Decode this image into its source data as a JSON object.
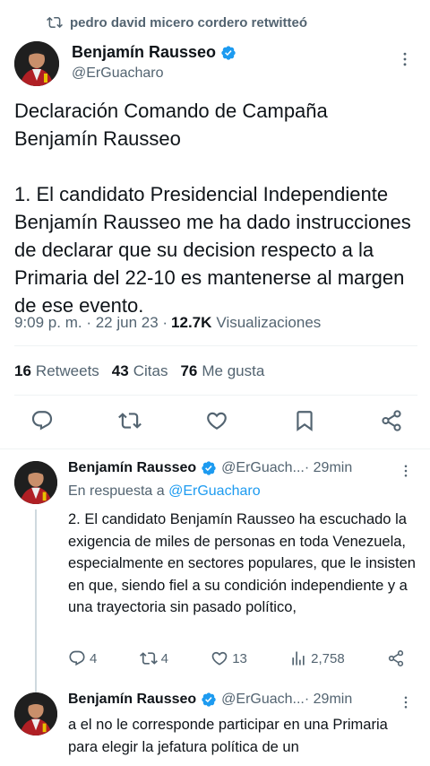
{
  "retweet": {
    "text": "pedro david micero cordero retwitteó"
  },
  "main_tweet": {
    "author_name": "Benjamín Rausseo",
    "handle": "@ErGuacharo",
    "text": "Declaración Comando de Campaña\nBenjamín Rausseo\n\n1. El candidato Presidencial Independiente Benjamín Rausseo me ha dado instrucciones de declarar que su decision respecto a la Primaria del 22-10 es mantenerse al margen de ese evento.",
    "meta_time": "9:09 p. m. · 22 jun 23 · ",
    "views_count": "12.7K",
    "views_label": "Visualizaciones",
    "stats": [
      {
        "count": "16",
        "label": "Retweets"
      },
      {
        "count": "43",
        "label": "Citas"
      },
      {
        "count": "76",
        "label": "Me gusta"
      }
    ]
  },
  "replies": [
    {
      "author_name": "Benjamín Rausseo",
      "handle": "@ErGuach...",
      "time": " · 29min",
      "in_reply_prefix": "En respuesta a ",
      "in_reply_handle": "@ErGuacharo",
      "text": "2. El candidato Benjamín Rausseo ha escuchado  la  exigencia de  miles de personas en toda Venezuela, especialmente en sectores populares,  que le insisten en que, siendo fiel a su condición independiente y a una trayectoria sin pasado político,",
      "reply_count": "4",
      "retweet_count": "4",
      "like_count": "13",
      "views_count": "2,758"
    },
    {
      "author_name": "Benjamín Rausseo",
      "handle": "@ErGuach...",
      "time": " · 29min",
      "text": "a el no le corresponde participar en una Primaria para elegir la jefatura política de un"
    }
  ],
  "colors": {
    "accent": "#1d9bf0",
    "secondary_text": "#536471",
    "verified": "#1d9bf0"
  }
}
